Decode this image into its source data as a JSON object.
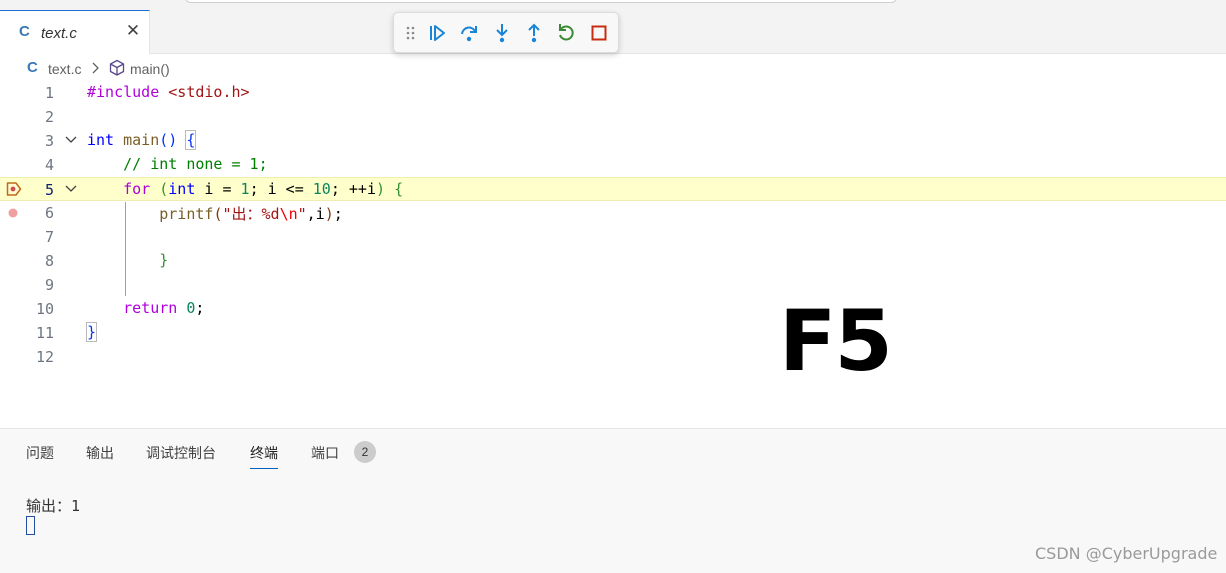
{
  "tab": {
    "icon": "C",
    "title": "text.c",
    "close": "✕"
  },
  "debug_toolbar": {
    "buttons": [
      "continue-icon",
      "step-over-icon",
      "step-into-icon",
      "step-out-icon",
      "restart-icon",
      "stop-icon"
    ],
    "colors": {
      "blue": "#1a85d6",
      "green": "#388a34",
      "red": "#c72e0f"
    }
  },
  "breadcrumb": {
    "icon": "C",
    "file": "text.c",
    "symbol": "main()"
  },
  "editor": {
    "line_numbers": [
      "1",
      "2",
      "3",
      "4",
      "5",
      "6",
      "7",
      "8",
      "9",
      "10",
      "11",
      "12"
    ],
    "current_line": "5",
    "line1": {
      "directive": "#include",
      "header": " <stdio.h>"
    },
    "line3": {
      "kw": "int",
      "name": " main",
      "paren": "()",
      "sp": " ",
      "brace": "{"
    },
    "line4": {
      "indent": "    ",
      "comment": "// int none = 1;"
    },
    "line5": {
      "indent": "    ",
      "kw_for": "for",
      "sp": " ",
      "paren_open": "(",
      "kw_int": "int",
      "a": " i = ",
      "n1": "1",
      "b": "; i <= ",
      "n2": "10",
      "c": "; ++i",
      "paren_close": ")",
      "sp2": " ",
      "brace": "{"
    },
    "line6": {
      "indent": "        ",
      "fn": "printf",
      "p_open": "(",
      "s1": "\"出：%d",
      "esc": "\\n",
      "s2": "\"",
      "rest": ",i",
      "p_close": ")",
      "semi": ";"
    },
    "line8": {
      "indent": "        ",
      "brace": "}"
    },
    "line10": {
      "indent": "    ",
      "kw": "return",
      "sp": " ",
      "num": "0",
      "semi": ";"
    },
    "line11": {
      "brace": "}"
    }
  },
  "overlay_text": "F5",
  "panel": {
    "tabs": [
      "问题",
      "输出",
      "调试控制台",
      "终端",
      "端口"
    ],
    "active_tab": "终端",
    "ports_badge": "2",
    "terminal_output": "输出：1"
  },
  "watermark": "CSDN @CyberUpgrade"
}
